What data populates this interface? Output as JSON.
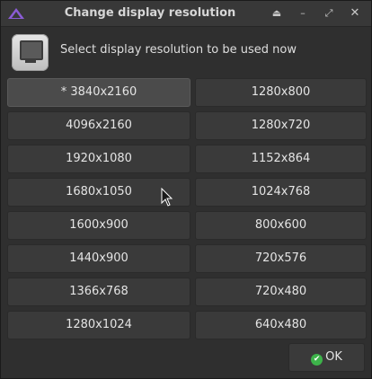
{
  "window": {
    "title": "Change display resolution",
    "controls": {
      "eject": "⏏",
      "minimize": "–",
      "maximize": "⤢",
      "close": "✕"
    }
  },
  "header": {
    "icon": "monitor-icon",
    "prompt": "Select display resolution to be used now"
  },
  "resolutions": {
    "left": [
      "* 3840x2160",
      "4096x2160",
      "1920x1080",
      "1680x1050",
      "1600x900",
      "1440x900",
      "1366x768",
      "1280x1024"
    ],
    "right": [
      "1280x800",
      "1280x720",
      "1152x864",
      "1024x768",
      "800x600",
      "720x576",
      "720x480",
      "640x480"
    ],
    "selected": "* 3840x2160"
  },
  "footer": {
    "ok_label": "OK",
    "ok_icon": "checkmark-icon",
    "check_glyph": "✔"
  },
  "colors": {
    "background": "#2f2f2f",
    "button": "#3a3a3a",
    "accent_ok": "#3db34a",
    "app_icon": "#8b5cd6"
  }
}
